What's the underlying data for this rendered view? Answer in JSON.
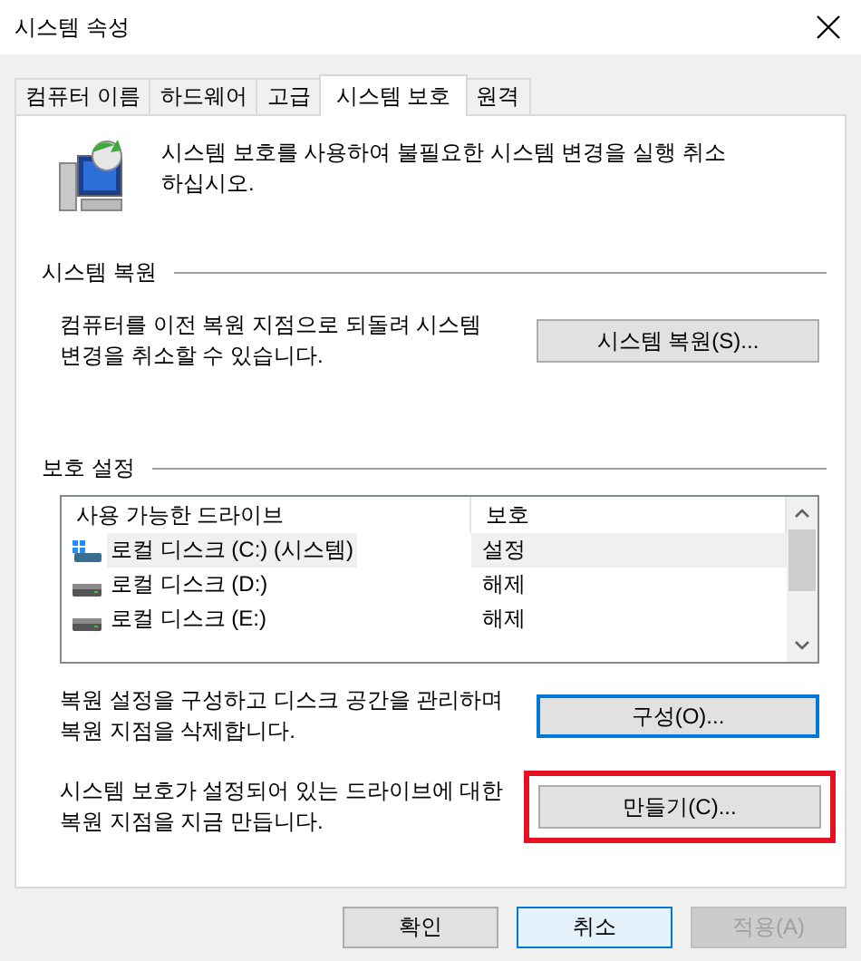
{
  "window": {
    "title": "시스템 속성"
  },
  "tabs": [
    {
      "label": "컴퓨터 이름",
      "selected": false
    },
    {
      "label": "하드웨어",
      "selected": false
    },
    {
      "label": "고급",
      "selected": false
    },
    {
      "label": "시스템 보호",
      "selected": true
    },
    {
      "label": "원격",
      "selected": false
    }
  ],
  "intro": "시스템 보호를 사용하여 불필요한 시스템 변경을 실행 취소하십시오.",
  "restore_section": {
    "heading": "시스템 복원",
    "text": "컴퓨터를 이전 복원 지점으로 되돌려 시스템 변경을 취소할 수 있습니다.",
    "button": {
      "label": "시스템 복원(S)...",
      "focused": false,
      "highlighted": false
    }
  },
  "protection_section": {
    "heading": "보호 설정",
    "table": {
      "columns": [
        "사용 가능한 드라이브",
        "보호"
      ],
      "rows": [
        {
          "kind": "system",
          "drive": "로컬 디스크 (C:) (시스템)",
          "protection": "설정",
          "selected": true
        },
        {
          "kind": "disk",
          "drive": "로컬 디스크 (D:)",
          "protection": "해제",
          "selected": false
        },
        {
          "kind": "disk",
          "drive": "로컬 디스크 (E:)",
          "protection": "해제",
          "selected": false
        }
      ]
    },
    "configure": {
      "text": "복원 설정을 구성하고 디스크 공간을 관리하며 복원 지점을 삭제합니다.",
      "button": {
        "label": "구성(O)...",
        "focused": true,
        "highlighted": false
      }
    },
    "create": {
      "text": "시스템 보호가 설정되어 있는 드라이브에 대한 복원 지점을 지금 만듭니다.",
      "button": {
        "label": "만들기(C)...",
        "focused": false,
        "highlighted": true
      }
    }
  },
  "buttons": [
    {
      "label": "확인",
      "default": false,
      "disabled": false
    },
    {
      "label": "취소",
      "default": true,
      "disabled": false
    },
    {
      "label": "적용(A)",
      "default": false,
      "disabled": true
    }
  ]
}
